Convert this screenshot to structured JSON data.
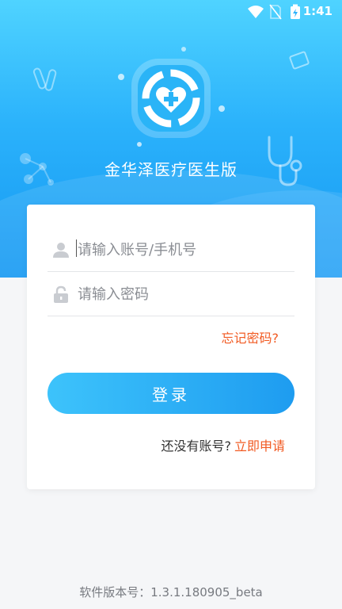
{
  "status_bar": {
    "time": "1:41",
    "icons": [
      "wifi-icon",
      "no-sim-icon",
      "battery-charging-icon"
    ]
  },
  "app": {
    "title": "金华泽医疗医生版",
    "logo_icon": "heart-plus-logo-icon"
  },
  "login_form": {
    "username_placeholder": "请输入账号/手机号",
    "password_placeholder": "请输入密码",
    "forgot_password": "忘记密码?",
    "login_button": "登录",
    "no_account_text": "还没有账号?",
    "register_link": "立即申请"
  },
  "footer": {
    "version": "软件版本号：1.3.1.180905_beta"
  },
  "colors": {
    "primary": "#1e9cf0",
    "accent": "#f15a22",
    "background": "#f5f6f8"
  }
}
